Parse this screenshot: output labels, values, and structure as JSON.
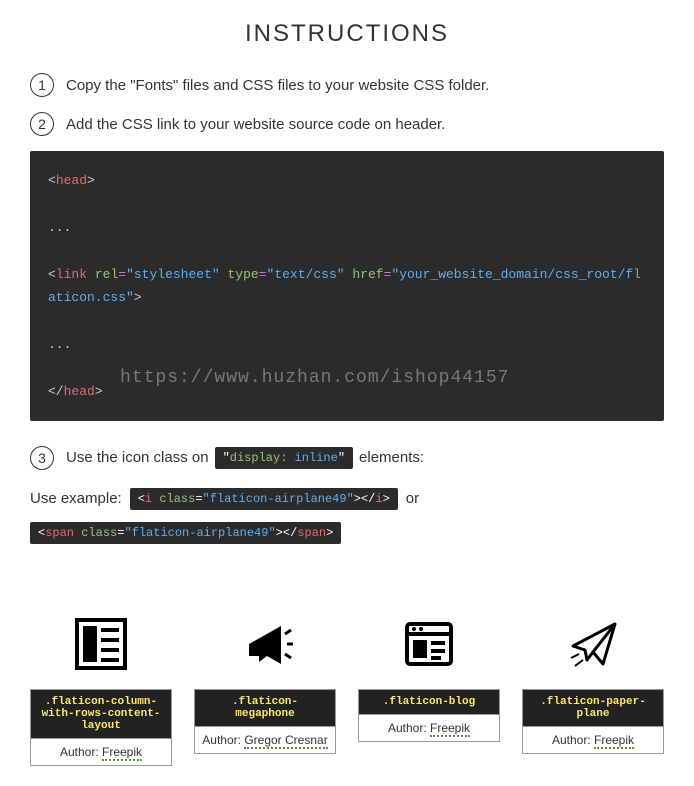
{
  "title": "INSTRUCTIONS",
  "steps": {
    "s1": {
      "num": "1",
      "text": "Copy the \"Fonts\" files and CSS files to your website CSS folder."
    },
    "s2": {
      "num": "2",
      "text": "Add the CSS link to your website source code on header."
    },
    "s3": {
      "num": "3",
      "prefix": "Use the icon class on ",
      "code_display": "display:",
      "code_inline": " inline",
      "suffix": " elements:"
    }
  },
  "code": {
    "head_open": "head",
    "dots": "...",
    "link": "link",
    "rel_attr": "rel",
    "rel_val": "\"stylesheet\"",
    "type_attr": "type",
    "type_val": "\"text/css\"",
    "href_attr": "href",
    "href_val": "\"your_website_domain/css_root/flaticon.css\"",
    "head_close": "head"
  },
  "example": {
    "label": "Use example: ",
    "i_tag": "i",
    "class_attr": "class",
    "class_val": "\"flaticon-airplane49\"",
    "or": " or",
    "span_tag": "span"
  },
  "icons": [
    {
      "class": ".flaticon-column-with-rows-content-layout",
      "author_prefix": "Author: ",
      "author": "Freepik"
    },
    {
      "class": ".flaticon-megaphone",
      "author_prefix": "Author: ",
      "author": "Gregor Cresnar"
    },
    {
      "class": ".flaticon-blog",
      "author_prefix": "Author: ",
      "author": "Freepik"
    },
    {
      "class": ".flaticon-paper-plane",
      "author_prefix": "Author: ",
      "author": "Freepik"
    }
  ],
  "watermark": "https://www.huzhan.com/ishop44157"
}
